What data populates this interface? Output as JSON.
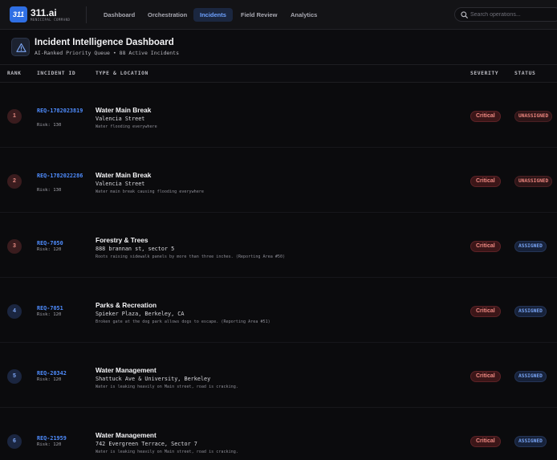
{
  "nav": {
    "logo_mark": "311",
    "brand": "311.ai",
    "brand_sub": "MUNICIPAL COMMAND",
    "items": [
      {
        "label": "Dashboard",
        "active": false
      },
      {
        "label": "Orchestration",
        "active": false
      },
      {
        "label": "Incidents",
        "active": true
      },
      {
        "label": "Field Review",
        "active": false
      },
      {
        "label": "Analytics",
        "active": false
      }
    ],
    "search_placeholder": "Search operations..."
  },
  "header": {
    "icon": "warning-triangle-icon",
    "title": "Incident Intelligence Dashboard",
    "subtitle": "AI-Ranked Priority Queue • 88 Active Incidents"
  },
  "table": {
    "columns": {
      "rank": "RANK",
      "incident_id": "INCIDENT ID",
      "type_location": "TYPE & LOCATION",
      "severity": "SEVERITY",
      "status": "STATUS"
    },
    "rows": [
      {
        "rank": "1",
        "id": "REQ-1782023819",
        "risk": "Risk: 130",
        "type": "Water Main Break",
        "location": "Valencia Street",
        "description": "Water flooding everywhere",
        "severity": "Critical",
        "status": "UNASSIGNED"
      },
      {
        "rank": "2",
        "id": "REQ-1782022286",
        "risk": "Risk: 130",
        "type": "Water Main Break",
        "location": "Valencia Street",
        "description": "Water main break causing flooding everywhere",
        "severity": "Critical",
        "status": "UNASSIGNED"
      },
      {
        "rank": "3",
        "id": "REQ-7050",
        "risk": "Risk: 120",
        "type": "Forestry & Trees",
        "location": "888 brannan st, sector 5",
        "description": "Roots raising sidewalk panels by more than three inches. (Reporting Area #50)",
        "severity": "Critical",
        "status": "ASSIGNED"
      },
      {
        "rank": "4",
        "id": "REQ-7051",
        "risk": "Risk: 120",
        "type": "Parks & Recreation",
        "location": "Spieker Plaza, Berkeley, CA",
        "description": "Broken gate at the dog park allows dogs to escape. (Reporting Area #51)",
        "severity": "Critical",
        "status": "ASSIGNED"
      },
      {
        "rank": "5",
        "id": "REQ-20342",
        "risk": "Risk: 120",
        "type": "Water Management",
        "location": "Shattuck Ave & University, Berkeley",
        "description": "Water is leaking heavily on Main street, road is cracking.",
        "severity": "Critical",
        "status": "ASSIGNED"
      },
      {
        "rank": "6",
        "id": "REQ-21959",
        "risk": "Risk: 120",
        "type": "Water Management",
        "location": "742 Evergreen Terrace, Sector 7",
        "description": "Water is leaking heavily on Main street, road is cracking.",
        "severity": "Critical",
        "status": "ASSIGNED"
      }
    ]
  }
}
